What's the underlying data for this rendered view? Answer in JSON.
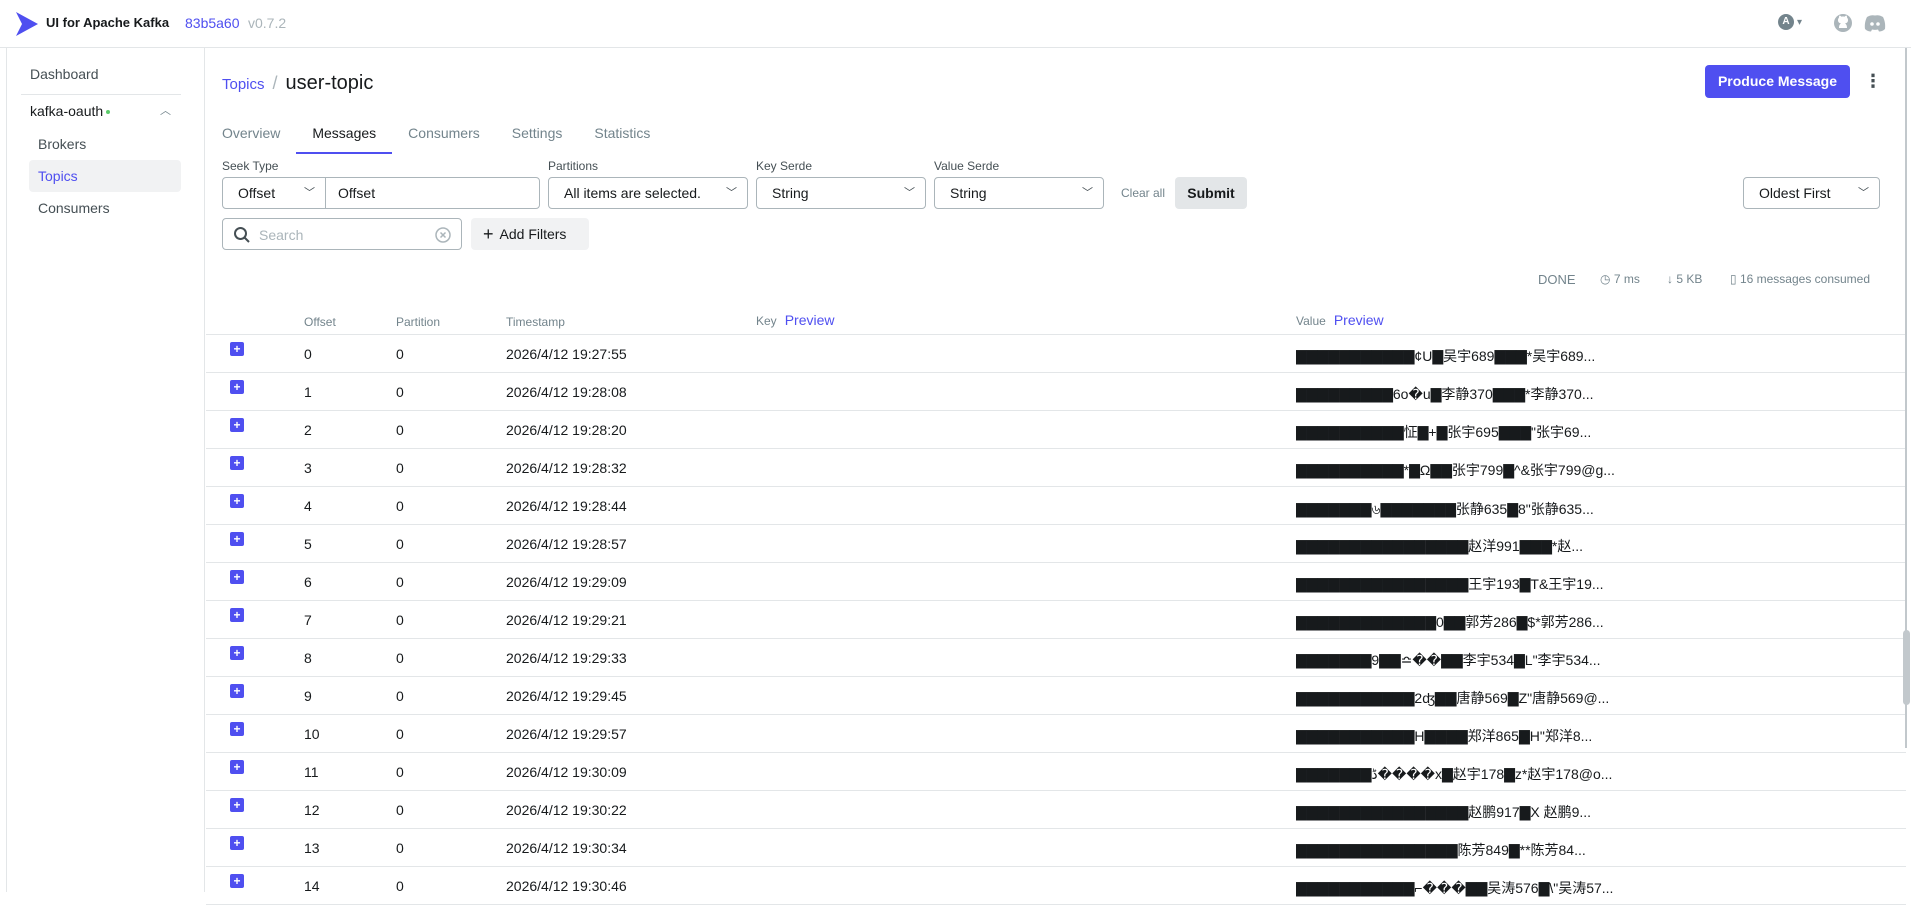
{
  "app": {
    "brand": "UI for Apache Kafka",
    "commit": "83b5a60",
    "version": "v0.7.2",
    "user_initial": "A"
  },
  "sidebar": {
    "dashboard": "Dashboard",
    "cluster": "kafka-oauth",
    "items": [
      "Brokers",
      "Topics",
      "Consumers"
    ]
  },
  "breadcrumb": {
    "parent": "Topics",
    "separator": "/",
    "current": "user-topic"
  },
  "actions": {
    "produce": "Produce Message"
  },
  "tabs": [
    "Overview",
    "Messages",
    "Consumers",
    "Settings",
    "Statistics"
  ],
  "filters": {
    "seek_type_label": "Seek Type",
    "seek_type_value": "Offset",
    "offset_value": "Offset",
    "partitions_label": "Partitions",
    "partitions_value": "All items are selected.",
    "key_serde_label": "Key Serde",
    "key_serde_value": "String",
    "value_serde_label": "Value Serde",
    "value_serde_value": "String",
    "clear_all": "Clear all",
    "submit": "Submit",
    "sort": "Oldest First",
    "search_placeholder": "Search",
    "add_filters": "Add Filters"
  },
  "status": {
    "state": "DONE",
    "time": "7 ms",
    "size": "5 KB",
    "consumed": "16 messages consumed"
  },
  "table": {
    "headers": {
      "offset": "Offset",
      "partition": "Partition",
      "timestamp": "Timestamp",
      "key": "Key",
      "key_preview": "Preview",
      "value": "Value",
      "value_preview": "Preview"
    },
    "rows": [
      {
        "offset": "0",
        "partition": "0",
        "timestamp": "2026/4/12 19:27:55",
        "value": "▇▇▇▇▇▇▇▇▇▇▇¢U▇吴宇689▇▇▇*吴宇689..."
      },
      {
        "offset": "1",
        "partition": "0",
        "timestamp": "2026/4/12 19:28:08",
        "value": "▇▇▇▇▇▇▇▇▇6o�u▇李静370▇▇▇*李静370..."
      },
      {
        "offset": "2",
        "partition": "0",
        "timestamp": "2026/4/12 19:28:20",
        "value": "▇▇▇▇▇▇▇▇▇▇怔▇+▇张宇695▇▇▇\"张宇69..."
      },
      {
        "offset": "3",
        "partition": "0",
        "timestamp": "2026/4/12 19:28:32",
        "value": "▇▇▇▇▇▇▇▇▇▇*▇Ω▇▇张宇799▇^&张宇799@g..."
      },
      {
        "offset": "4",
        "partition": "0",
        "timestamp": "2026/4/12 19:28:44",
        "value": "▇▇▇▇▇▇▇৬▇▇▇▇▇▇▇张静635▇8\"张静635..."
      },
      {
        "offset": "5",
        "partition": "0",
        "timestamp": "2026/4/12 19:28:57",
        "value": "▇▇▇▇▇▇▇▇▇▇▇▇▇▇▇▇赵洋991▇▇▇*赵..."
      },
      {
        "offset": "6",
        "partition": "0",
        "timestamp": "2026/4/12 19:29:09",
        "value": "▇▇▇▇▇▇▇▇▇▇▇▇▇▇▇▇王宇193▇T&王宇19..."
      },
      {
        "offset": "7",
        "partition": "0",
        "timestamp": "2026/4/12 19:29:21",
        "value": "▇▇▇▇▇▇▇▇▇▇▇▇▇0▇▇郭芳286▇$*郭芳286..."
      },
      {
        "offset": "8",
        "partition": "0",
        "timestamp": "2026/4/12 19:29:33",
        "value": "▇▇▇▇▇▇▇9▇▇≏��▇▇李宇534▇L\"李宇534..."
      },
      {
        "offset": "9",
        "partition": "0",
        "timestamp": "2026/4/12 19:29:45",
        "value": "▇▇▇▇▇▇▇▇▇▇▇2ʤ▇▇唐静569▇Z\"唐静569@..."
      },
      {
        "offset": "10",
        "partition": "0",
        "timestamp": "2026/4/12 19:29:57",
        "value": "▇▇▇▇▇▇▇▇▇▇▇H▇▇▇▇郑洋865▇H\"郑洋8..."
      },
      {
        "offset": "11",
        "partition": "0",
        "timestamp": "2026/4/12 19:30:09",
        "value": "▇▇▇▇▇▇▇ڈ����x▇赵宇178▇z*赵宇178@o..."
      },
      {
        "offset": "12",
        "partition": "0",
        "timestamp": "2026/4/12 19:30:22",
        "value": "▇▇▇▇▇▇▇▇▇▇▇▇▇▇▇▇赵鹏917▇X 赵鹏9..."
      },
      {
        "offset": "13",
        "partition": "0",
        "timestamp": "2026/4/12 19:30:34",
        "value": "▇▇▇▇▇▇▇▇▇▇▇▇▇▇▇陈芳849▇**陈芳84..."
      },
      {
        "offset": "14",
        "partition": "0",
        "timestamp": "2026/4/12 19:30:46",
        "value": "▇▇▇▇▇▇▇▇▇▇▇⌐���▇▇吴涛576▇\\\"吴涛57..."
      }
    ]
  }
}
